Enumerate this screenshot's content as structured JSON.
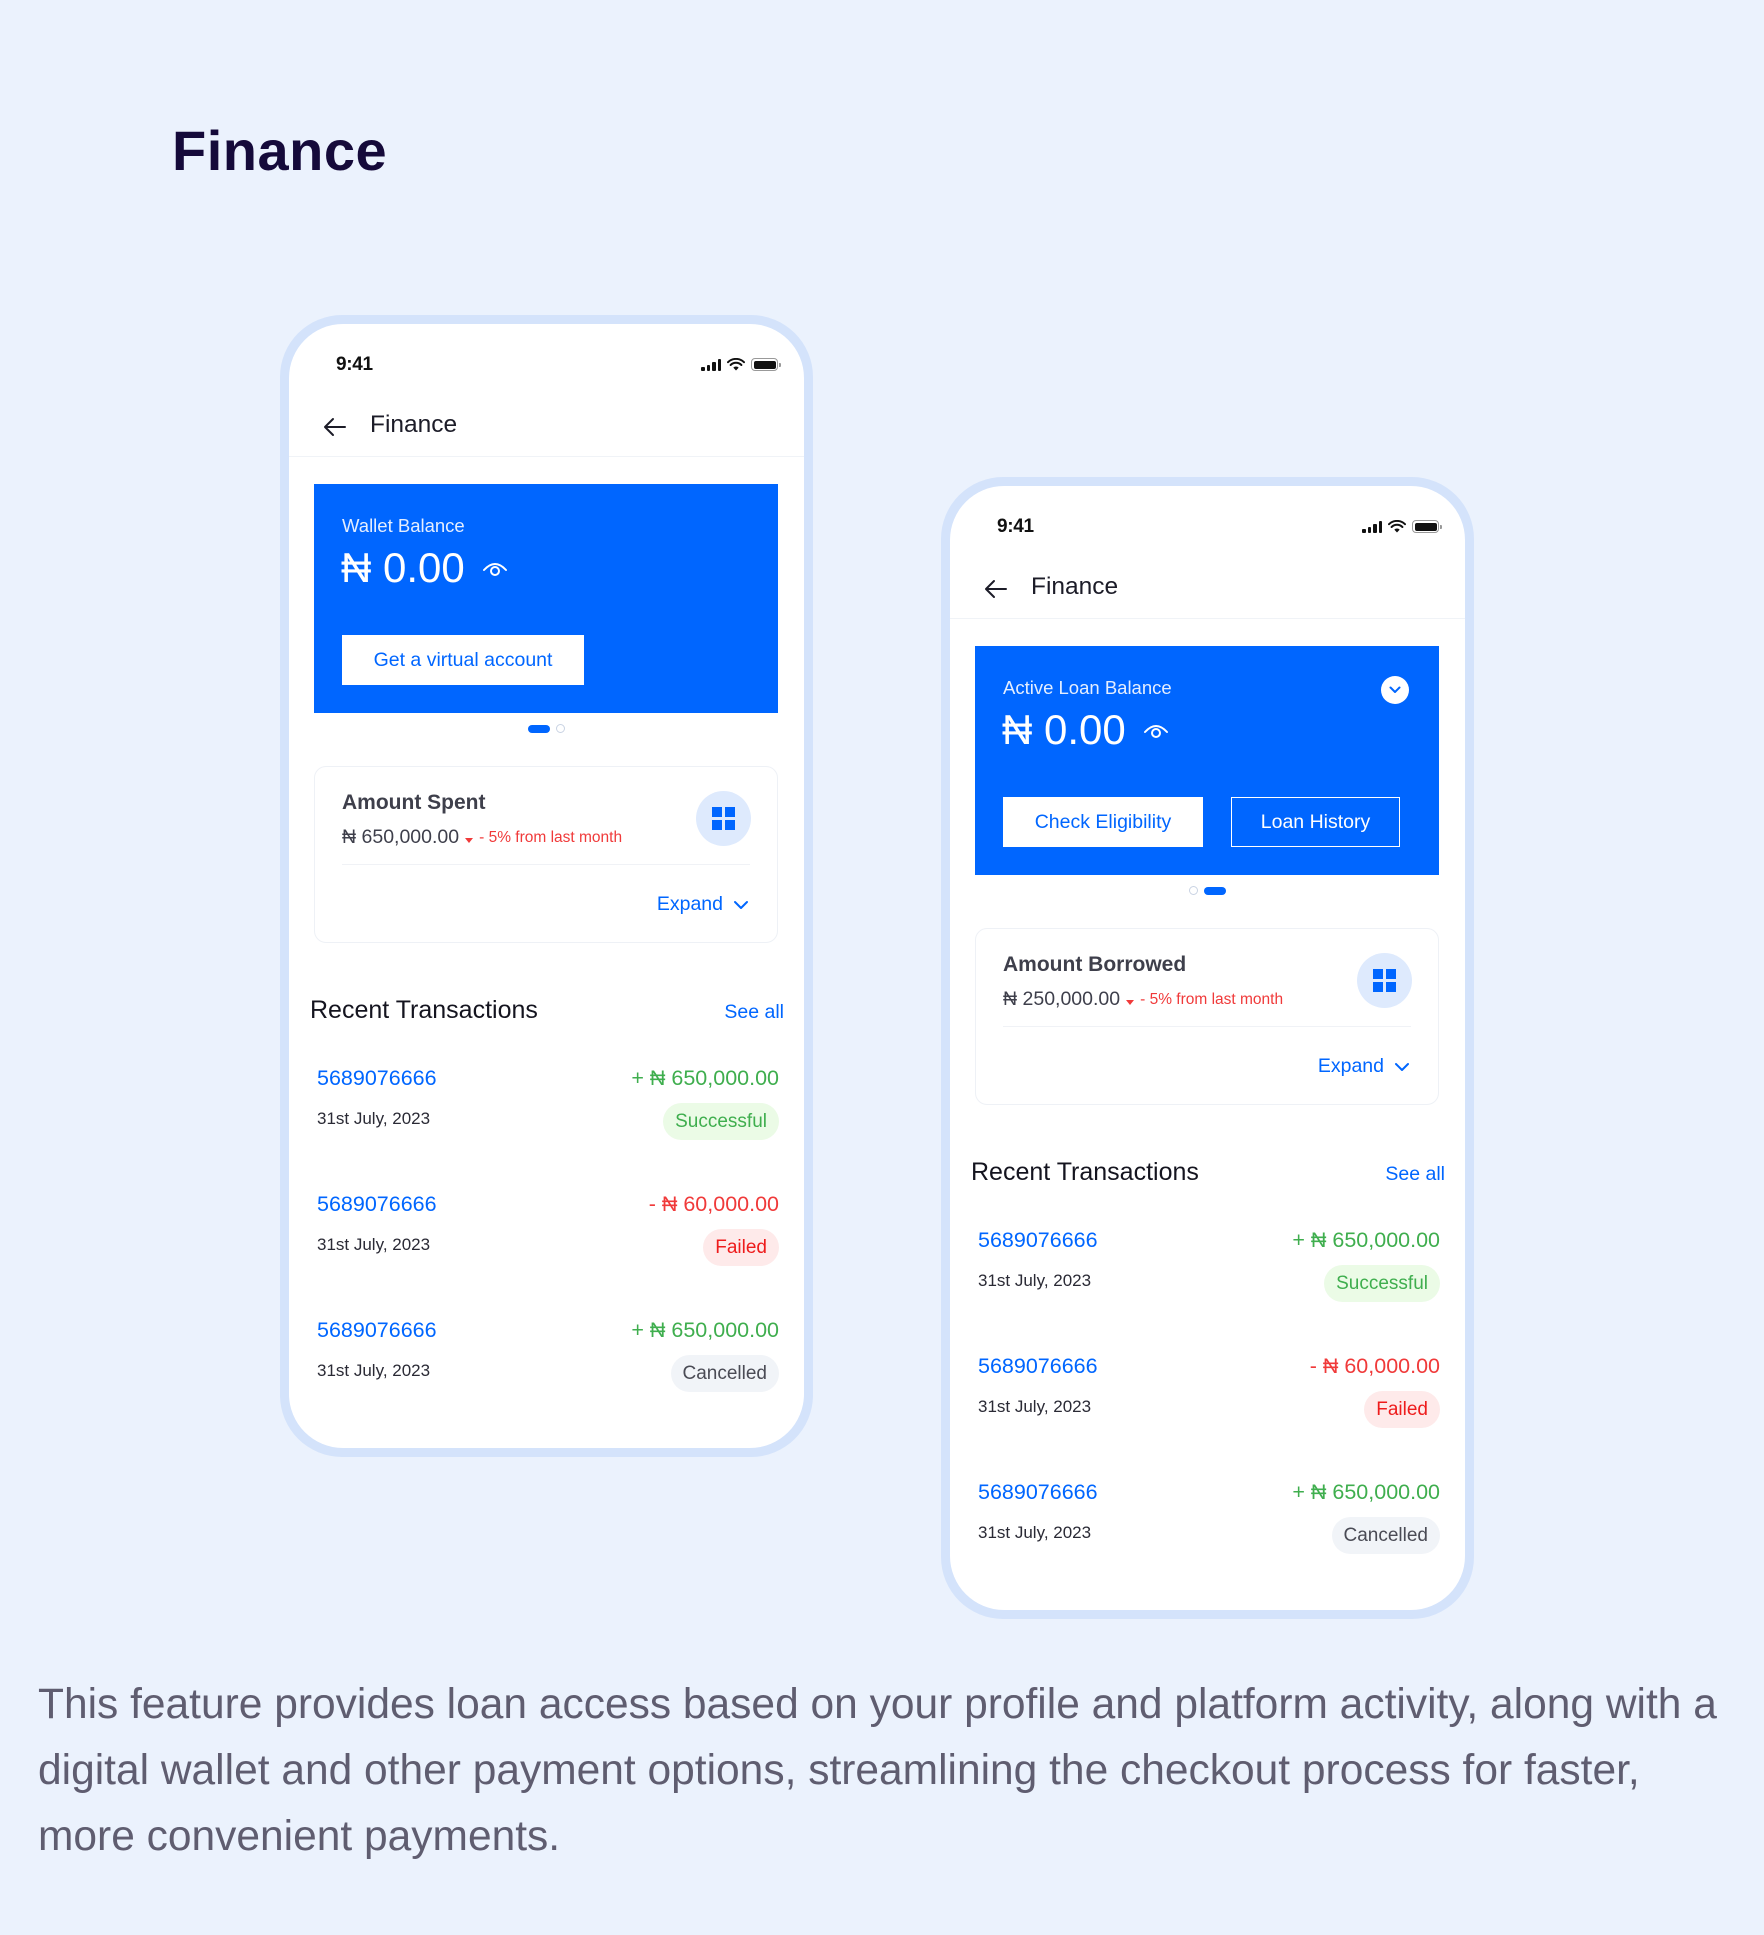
{
  "page": {
    "title": "Finance",
    "description": "This feature provides loan access based on your profile and platform activity, along with a digital wallet and other payment options, streamlining the checkout process for faster, more convenient payments."
  },
  "colors": {
    "background": "#ebf2fd",
    "primary": "#0066ff",
    "success": "#3fae4e",
    "danger": "#f03a3a",
    "frame": "#d4e3fb"
  },
  "phones": [
    {
      "status_bar": {
        "time": "9:41",
        "icons": [
          "signal-icon",
          "wifi-icon",
          "battery-icon"
        ]
      },
      "header": {
        "back_icon": "arrow-left-icon",
        "title": "Finance"
      },
      "balance_card": {
        "label": "Wallet Balance",
        "amount": "₦ 0.00",
        "visibility_icon": "eye-icon",
        "primary_button": "Get a virtual account",
        "carousel": {
          "total": 2,
          "active": 1
        }
      },
      "stat_card": {
        "title": "Amount Spent",
        "value": "₦ 650,000.00",
        "trend": "down",
        "change": "- 5% from last month",
        "icon": "grid-icon",
        "expand_label": "Expand"
      },
      "recent": {
        "title": "Recent Transactions",
        "see_all": "See all",
        "transactions": [
          {
            "id": "5689076666",
            "date": "31st July, 2023",
            "amount": "+ ₦ 650,000.00",
            "direction": "credit",
            "status": "Successful"
          },
          {
            "id": "5689076666",
            "date": "31st July, 2023",
            "amount": "- ₦ 60,000.00",
            "direction": "debit",
            "status": "Failed"
          },
          {
            "id": "5689076666",
            "date": "31st July, 2023",
            "amount": "+ ₦ 650,000.00",
            "direction": "credit",
            "status": "Cancelled"
          }
        ]
      }
    },
    {
      "status_bar": {
        "time": "9:41",
        "icons": [
          "signal-icon",
          "wifi-icon",
          "battery-icon"
        ]
      },
      "header": {
        "back_icon": "arrow-left-icon",
        "title": "Finance"
      },
      "balance_card": {
        "label": "Active Loan Balance",
        "amount": "₦ 0.00",
        "visibility_icon": "eye-icon",
        "dropdown_icon": "chevron-down-icon",
        "primary_button": "Check Eligibility",
        "secondary_button": "Loan History",
        "carousel": {
          "total": 2,
          "active": 2
        }
      },
      "stat_card": {
        "title": "Amount Borrowed",
        "value": "₦ 250,000.00",
        "trend": "down",
        "change": "- 5% from last month",
        "icon": "grid-icon",
        "expand_label": "Expand"
      },
      "recent": {
        "title": "Recent Transactions",
        "see_all": "See all",
        "transactions": [
          {
            "id": "5689076666",
            "date": "31st July, 2023",
            "amount": "+ ₦ 650,000.00",
            "direction": "credit",
            "status": "Successful"
          },
          {
            "id": "5689076666",
            "date": "31st July, 2023",
            "amount": "- ₦ 60,000.00",
            "direction": "debit",
            "status": "Failed"
          },
          {
            "id": "5689076666",
            "date": "31st July, 2023",
            "amount": "+ ₦ 650,000.00",
            "direction": "credit",
            "status": "Cancelled"
          }
        ]
      }
    }
  ]
}
